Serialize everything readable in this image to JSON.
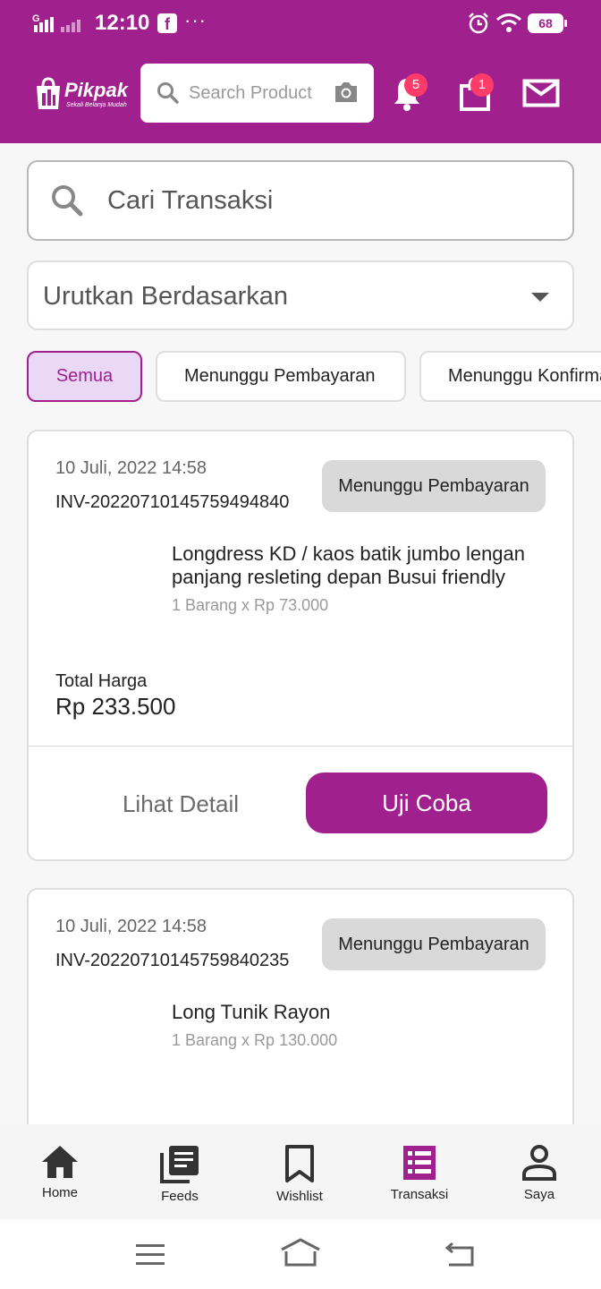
{
  "status_bar": {
    "time": "12:10",
    "network": "G",
    "battery": "68"
  },
  "header": {
    "logo_text": "Pikpak",
    "logo_tagline": "Sekali Belanja Mudah",
    "search_placeholder": "Search Product",
    "notification_count": "5",
    "cart_count": "1",
    "brand_color": "#a0208e"
  },
  "filters": {
    "search_placeholder": "Cari Transaksi",
    "sort_label": "Urutkan Berdasarkan",
    "chips": [
      {
        "label": "Semua",
        "active": true
      },
      {
        "label": "Menunggu Pembayaran",
        "active": false
      },
      {
        "label": "Menunggu Konfirmasi",
        "active": false
      }
    ]
  },
  "transactions": [
    {
      "date": "10 Juli, 2022 14:58",
      "invoice": "INV-20220710145759494840",
      "status": "Menunggu Pembayaran",
      "product_name": "Longdress KD / kaos batik jumbo lengan panjang resleting depan Busui friendly",
      "quantity_price": "1 Barang x Rp 73.000",
      "total_label": "Total Harga",
      "total_value": "Rp 233.500",
      "detail_label": "Lihat Detail",
      "action_label": "Uji Coba"
    },
    {
      "date": "10 Juli, 2022 14:58",
      "invoice": "INV-20220710145759840235",
      "status": "Menunggu Pembayaran",
      "product_name": "Long Tunik Rayon",
      "quantity_price": "1 Barang x Rp 130.000"
    }
  ],
  "bottom_nav": [
    {
      "label": "Home",
      "icon": "home-icon",
      "active": false
    },
    {
      "label": "Feeds",
      "icon": "feeds-icon",
      "active": false
    },
    {
      "label": "Wishlist",
      "icon": "bookmark-icon",
      "active": false
    },
    {
      "label": "Transaksi",
      "icon": "list-icon",
      "active": true
    },
    {
      "label": "Saya",
      "icon": "person-icon",
      "active": false
    }
  ]
}
